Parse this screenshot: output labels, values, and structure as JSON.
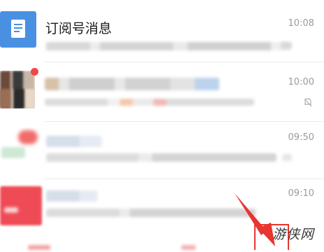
{
  "conversations": [
    {
      "title": "订阅号消息",
      "time": "10:08",
      "avatar_icon": "document-icon",
      "avatar_color": "#4a90e2"
    },
    {
      "title": "",
      "time": "10:00",
      "muted": true,
      "unread_dot": true
    },
    {
      "title": "",
      "time": "09:50"
    },
    {
      "title": "",
      "time": "09:10"
    }
  ],
  "watermark": "游侠网",
  "colors": {
    "accent": "#4a90e2",
    "annotation": "#e8352f"
  }
}
